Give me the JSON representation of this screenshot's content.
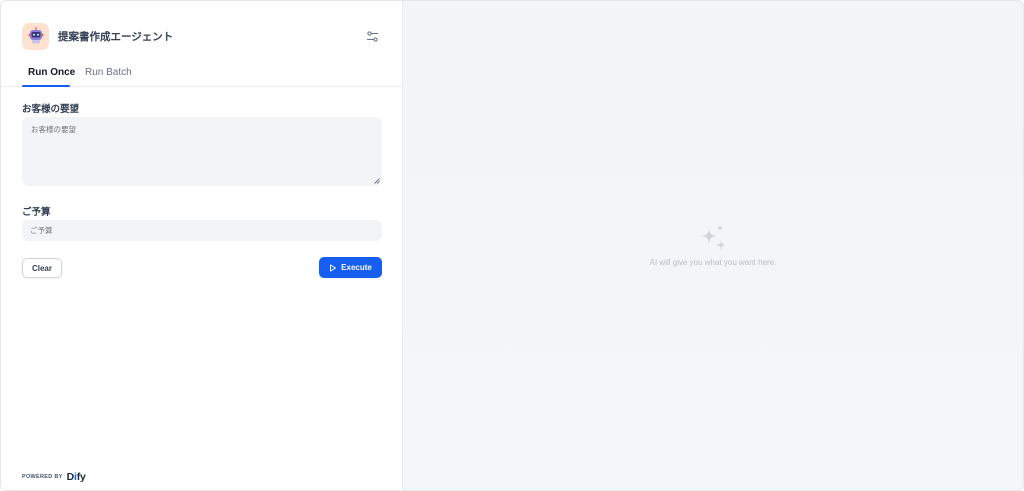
{
  "app": {
    "title": "提案書作成エージェント",
    "icon": "robot-emoji-icon",
    "icon_bg": "#fde3cf"
  },
  "tabs": [
    {
      "label": "Run Once",
      "active": true
    },
    {
      "label": "Run Batch",
      "active": false
    }
  ],
  "form": {
    "fields": [
      {
        "label": "お客様の要望",
        "placeholder": "お客様の要望",
        "value": "",
        "type": "textarea"
      },
      {
        "label": "ご予算",
        "placeholder": "ご予算",
        "value": "",
        "type": "text"
      }
    ],
    "clear_label": "Clear",
    "execute_label": "Execute"
  },
  "footer": {
    "powered_by": "POWERED BY",
    "brand": "Dify"
  },
  "result": {
    "empty_message": "AI will give you what you want here.",
    "icon": "sparkles-icon"
  },
  "colors": {
    "accent": "#155eef",
    "panel_bg": "#f2f4f7"
  }
}
